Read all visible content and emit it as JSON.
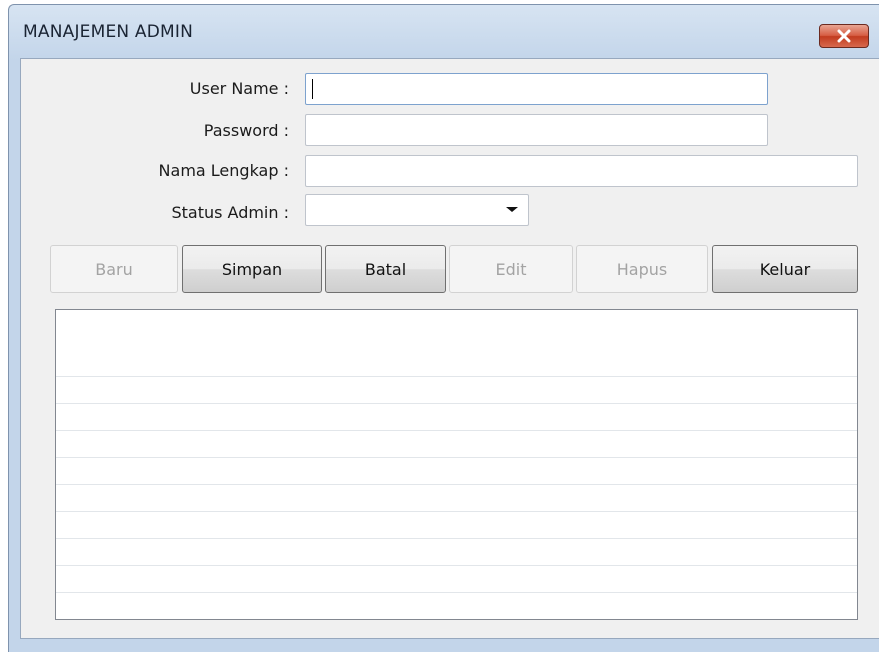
{
  "window": {
    "title": "MANAJEMEN ADMIN",
    "close_icon": "close-icon"
  },
  "form": {
    "username_label": "User Name :",
    "username_value": "",
    "password_label": "Password :",
    "password_value": "",
    "fullname_label": "Nama Lengkap :",
    "fullname_value": "",
    "status_label": "Status Admin :",
    "status_value": "",
    "status_icon": "chevron-down-icon"
  },
  "buttons": {
    "baru": "Baru",
    "simpan": "Simpan",
    "batal": "Batal",
    "edit": "Edit",
    "hapus": "Hapus",
    "keluar": "Keluar"
  },
  "grid": {
    "rows": []
  },
  "colors": {
    "close_button": "#c94a2f",
    "disabled_text": "#a3a3a3"
  }
}
